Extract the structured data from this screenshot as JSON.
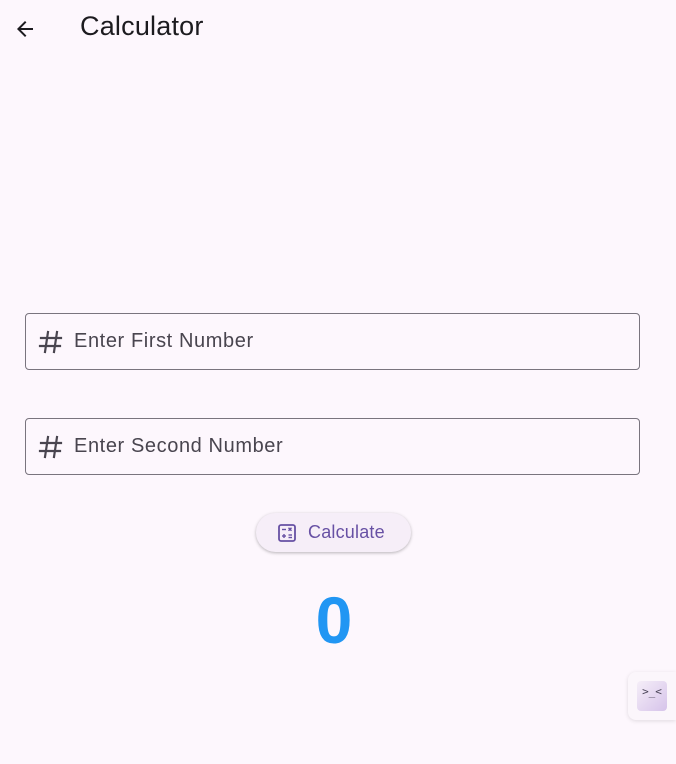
{
  "appbar": {
    "title": "Calculator",
    "back_icon": "arrow-back-icon"
  },
  "fields": {
    "first": {
      "placeholder": "Enter First Number",
      "value": "",
      "icon": "hash-icon"
    },
    "second": {
      "placeholder": "Enter Second Number",
      "value": "",
      "icon": "hash-icon"
    }
  },
  "calculate_button": {
    "label": "Calculate",
    "icon": "calculate-icon"
  },
  "result": {
    "value": "0"
  },
  "debug_fab": {
    "glyph": ">_<",
    "icon": "debug-face-icon"
  },
  "colors": {
    "background": "#fdf7fd",
    "primary": "#6750a4",
    "result": "#2196f3",
    "outline": "#79747e",
    "on_surface": "#1c1b1f"
  }
}
